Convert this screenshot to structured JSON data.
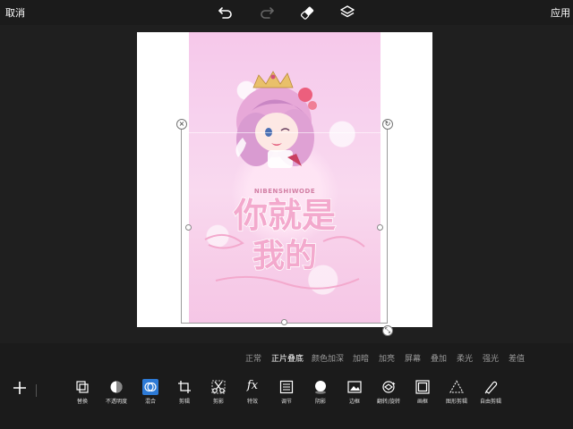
{
  "header": {
    "cancel_label": "取消",
    "apply_label": "应用"
  },
  "header_icons": [
    "undo-icon",
    "redo-icon",
    "eraser-icon",
    "layers-icon"
  ],
  "blend_modes": {
    "items": [
      "正常",
      "正片叠底",
      "颜色加深",
      "加暗",
      "加亮",
      "屏幕",
      "叠加",
      "柔光",
      "强光",
      "差值"
    ],
    "selected": "正片叠底"
  },
  "artwork": {
    "romanized_text": "NIBENSHIWODE",
    "line1": "你就是",
    "line2": "我的"
  },
  "tools": [
    {
      "label": "替换",
      "icon": "replace-icon"
    },
    {
      "label": "不透明度",
      "icon": "opacity-icon"
    },
    {
      "label": "混合",
      "icon": "blend-icon",
      "active": true
    },
    {
      "label": "剪辑",
      "icon": "crop-icon"
    },
    {
      "label": "剪影",
      "icon": "cutout-icon"
    },
    {
      "label": "特效",
      "icon": "fx-icon"
    },
    {
      "label": "调节",
      "icon": "adjust-icon"
    },
    {
      "label": "阴影",
      "icon": "shadow-icon"
    },
    {
      "label": "边框",
      "icon": "border-icon"
    },
    {
      "label": "翻转/旋转",
      "icon": "flip-rotate-icon"
    },
    {
      "label": "画框",
      "icon": "frame-icon"
    },
    {
      "label": "图形剪辑",
      "icon": "shape-crop-icon"
    },
    {
      "label": "自由剪辑",
      "icon": "free-crop-icon"
    }
  ],
  "colors": {
    "accent": "#2d7ad6",
    "background": "#1b1b1b",
    "pink": "#f7cde8"
  }
}
